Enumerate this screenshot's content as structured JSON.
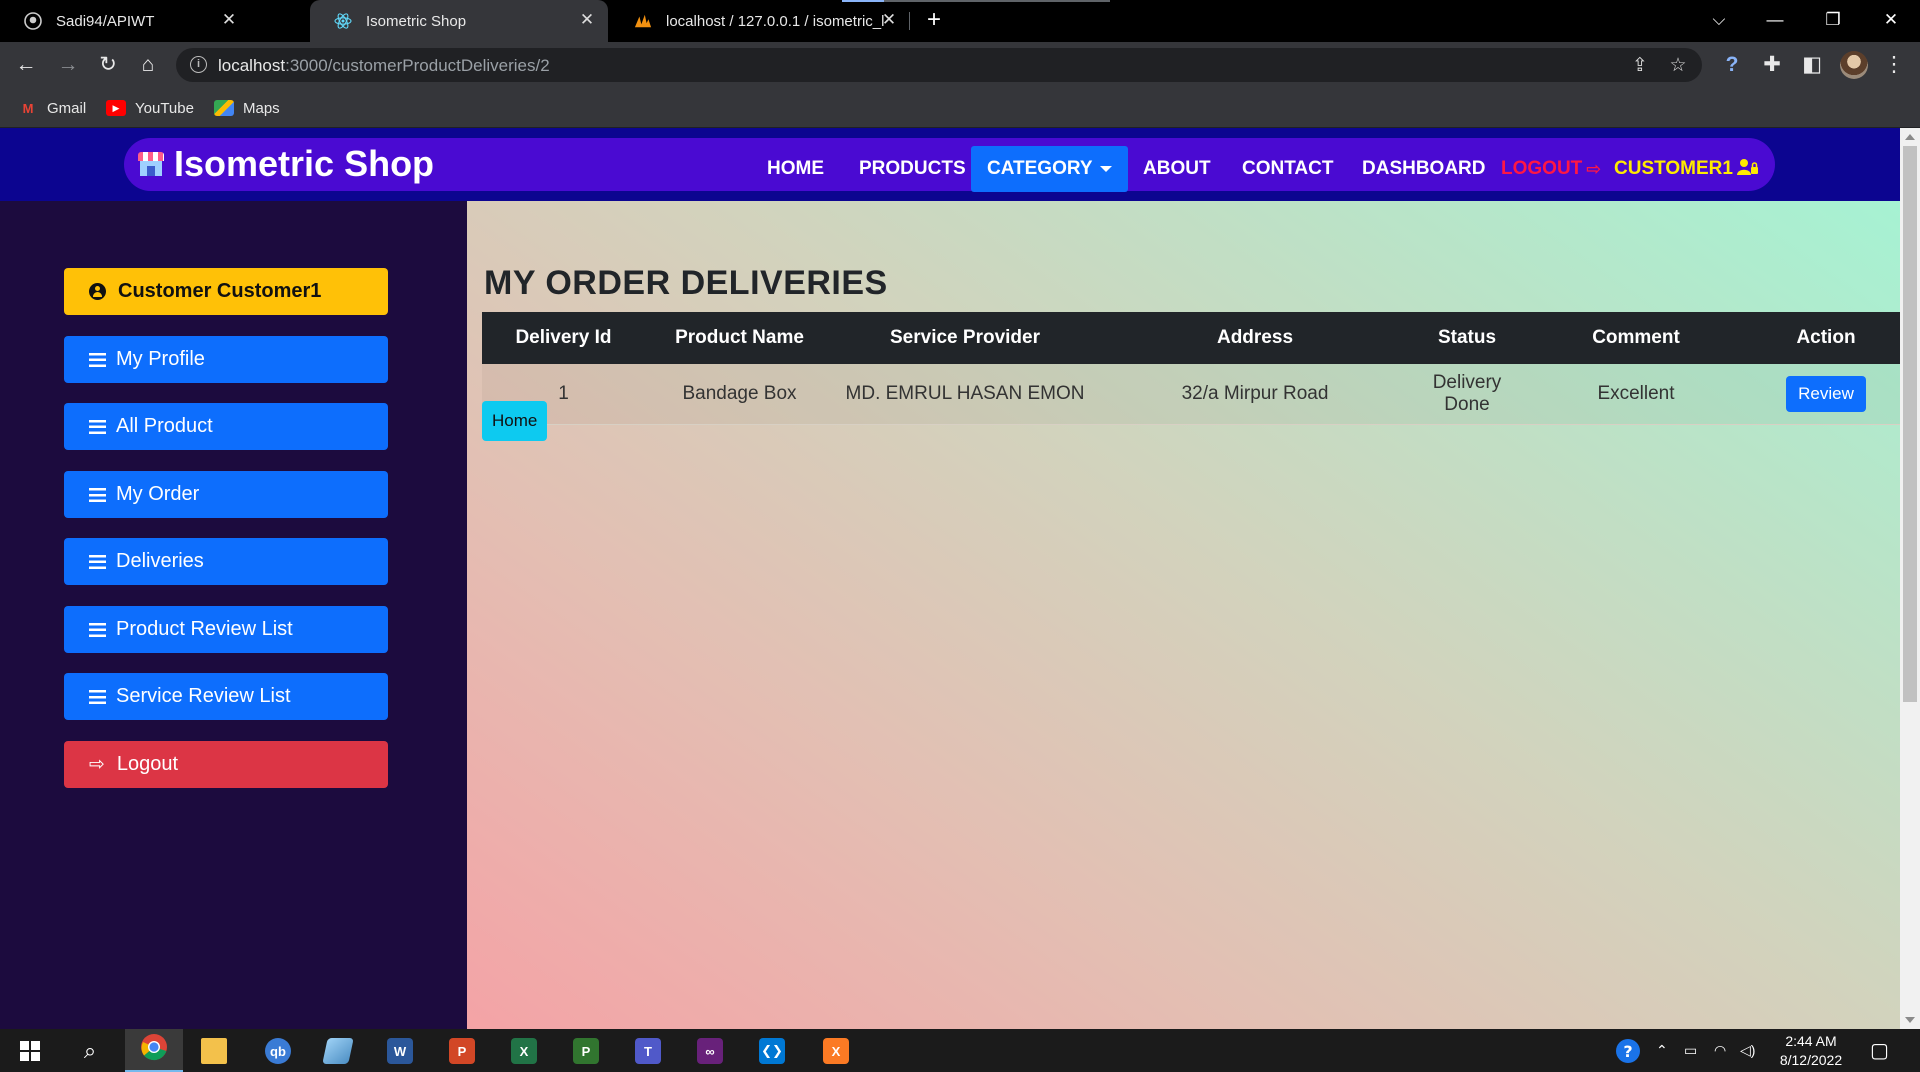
{
  "browser": {
    "tabs": [
      {
        "title": "Sadi94/APIWT",
        "icon": "github-icon"
      },
      {
        "title": "Isometric Shop",
        "icon": "react-icon"
      },
      {
        "title": "localhost / 127.0.0.1 / isometric_l",
        "icon": "phpmyadmin-icon"
      }
    ],
    "url_host": "localhost",
    "url_path": ":3000/customerProductDeliveries/2",
    "bookmarks": [
      {
        "label": "Gmail",
        "icon": "gmail-icon"
      },
      {
        "label": "YouTube",
        "icon": "youtube-icon"
      },
      {
        "label": "Maps",
        "icon": "maps-icon"
      }
    ]
  },
  "navbar": {
    "brand": "Isometric Shop",
    "links": [
      "HOME",
      "PRODUCTS",
      "CATEGORY",
      "ABOUT",
      "CONTACT",
      "DASHBOARD"
    ],
    "logout": "LOGOUT",
    "customer": "CUSTOMER1"
  },
  "sidebar": {
    "customer": "Customer Customer1",
    "items": [
      "My Profile",
      "All Product",
      "My Order",
      "Deliveries",
      "Product Review List",
      "Service Review List"
    ],
    "logout": "Logout"
  },
  "main": {
    "title": "MY ORDER DELIVERIES",
    "columns": [
      "Delivery Id",
      "Product Name",
      "Service Provider",
      "Address",
      "Status",
      "Comment",
      "Action"
    ],
    "rows": [
      {
        "id": "1",
        "product": "Bandage Box",
        "provider": "MD. EMRUL HASAN EMON",
        "address": "32/a Mirpur Road",
        "status": "Delivery Done",
        "comment": "Excellent",
        "action": "Review"
      }
    ],
    "home_button": "Home"
  },
  "taskbar": {
    "time": "2:44 AM",
    "date": "8/12/2022"
  },
  "colors": {
    "primary": "#0d6efd",
    "warning": "#ffc107",
    "danger": "#dc3545",
    "info": "#0dcaf0",
    "navbar": "#4a0ad2",
    "sidebar": "#1c0b3e"
  }
}
